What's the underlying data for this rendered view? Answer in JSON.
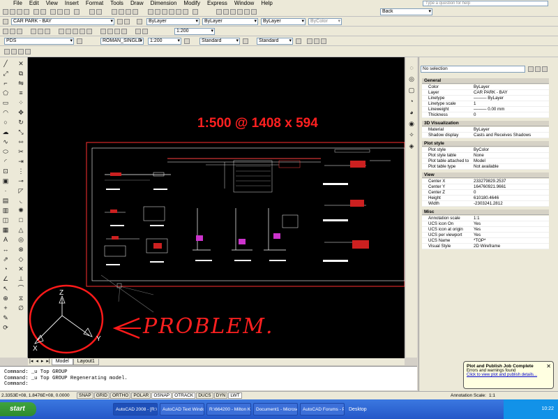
{
  "menu": [
    "File",
    "Edit",
    "View",
    "Insert",
    "Format",
    "Tools",
    "Draw",
    "Dimension",
    "Modify",
    "Express",
    "Window",
    "Help"
  ],
  "help_placeholder": "Type a question for help",
  "toolbar": {
    "view_combo": "Back",
    "layer_combo": "CAR PARK - BAY",
    "color_combo": "ByLayer",
    "linetype_combo": "ByLayer",
    "lineweight_combo": "ByLayer",
    "plotstyle_combo": "ByColor",
    "scale_combo": "1:200",
    "textstyle_combo": "PDS",
    "font_combo": "ROMAN_SINGLE",
    "dimscale_combo": "1:200",
    "dimstyle_combo": "Standard",
    "tablestyle_combo": "Standard",
    "mleader_combo": "Standard",
    "scale2_combo": "1:200"
  },
  "drawing": {
    "annotation": "1:500 @ 1408 x 594",
    "problem_label": "PROBLEM.",
    "ucs_labels": {
      "z": "Z",
      "x": "X",
      "y": "Y"
    }
  },
  "tabs": [
    "Model",
    "Layout1"
  ],
  "properties": {
    "selection": "No selection",
    "groups": [
      {
        "title": "General",
        "rows": [
          [
            "Color",
            "ByLayer"
          ],
          [
            "Layer",
            "CAR PARK - BAY"
          ],
          [
            "Linetype",
            "——— ByLayer"
          ],
          [
            "Linetype scale",
            "1"
          ],
          [
            "Lineweight",
            "——— 0.00 mm"
          ],
          [
            "Thickness",
            "0"
          ]
        ]
      },
      {
        "title": "3D Visualization",
        "rows": [
          [
            "Material",
            "ByLayer"
          ],
          [
            "Shadow display",
            "Casts and Receives Shadows"
          ]
        ]
      },
      {
        "title": "Plot style",
        "rows": [
          [
            "Plot style",
            "ByColor"
          ],
          [
            "Plot style table",
            "None"
          ],
          [
            "Plot table attached to",
            "Model"
          ],
          [
            "Plot table type",
            "Not available"
          ]
        ]
      },
      {
        "title": "View",
        "rows": [
          [
            "Center X",
            "233279829.2537"
          ],
          [
            "Center Y",
            "164760921.9661"
          ],
          [
            "Center Z",
            "0"
          ],
          [
            "Height",
            "610180.4646"
          ],
          [
            "Width",
            "-2303241.2812"
          ]
        ]
      },
      {
        "title": "Misc",
        "rows": [
          [
            "Annotation scale",
            "1:1"
          ],
          [
            "UCS icon On",
            "Yes"
          ],
          [
            "UCS icon at origin",
            "Yes"
          ],
          [
            "UCS per viewport",
            "Yes"
          ],
          [
            "UCS Name",
            "*TOP*"
          ],
          [
            "Visual Style",
            "2D Wireframe"
          ]
        ]
      }
    ]
  },
  "command_lines": [
    "Command: _u Top GROUP",
    "Command: _u Top GROUP Regenerating model.",
    "Command:"
  ],
  "status": {
    "coords": "2.3353E+08, 1.8476E+08, 0.0000",
    "buttons": [
      "SNAP",
      "GRID",
      "ORTHO",
      "POLAR",
      "OSNAP",
      "OTRACK",
      "DUCS",
      "DYN",
      "LWT"
    ],
    "on_buttons": [
      "OSNAP",
      "OTRACK",
      "LWT"
    ],
    "annotation_scale_label": "Annotation Scale:",
    "annotation_scale_value": "1:1"
  },
  "balloon": {
    "title": "Plot and Publish Job Complete",
    "line1": "Errors and warnings found",
    "link": "Click to view plot and publish details..."
  },
  "taskbar": {
    "start": "start",
    "tasks": [
      "AutoCAD 2008 - [R:\\...",
      "AutoCAD Text Windo...",
      "R:\\664200 - Milton Ke...",
      "Document1 - Microsof...",
      "AutoCAD Forums - Po..."
    ],
    "desktop": "Desktop",
    "time": "10:22"
  },
  "colors": {
    "accent_red": "#ff2020",
    "canvas": "#000000",
    "xp_blue": "#2457c8"
  }
}
